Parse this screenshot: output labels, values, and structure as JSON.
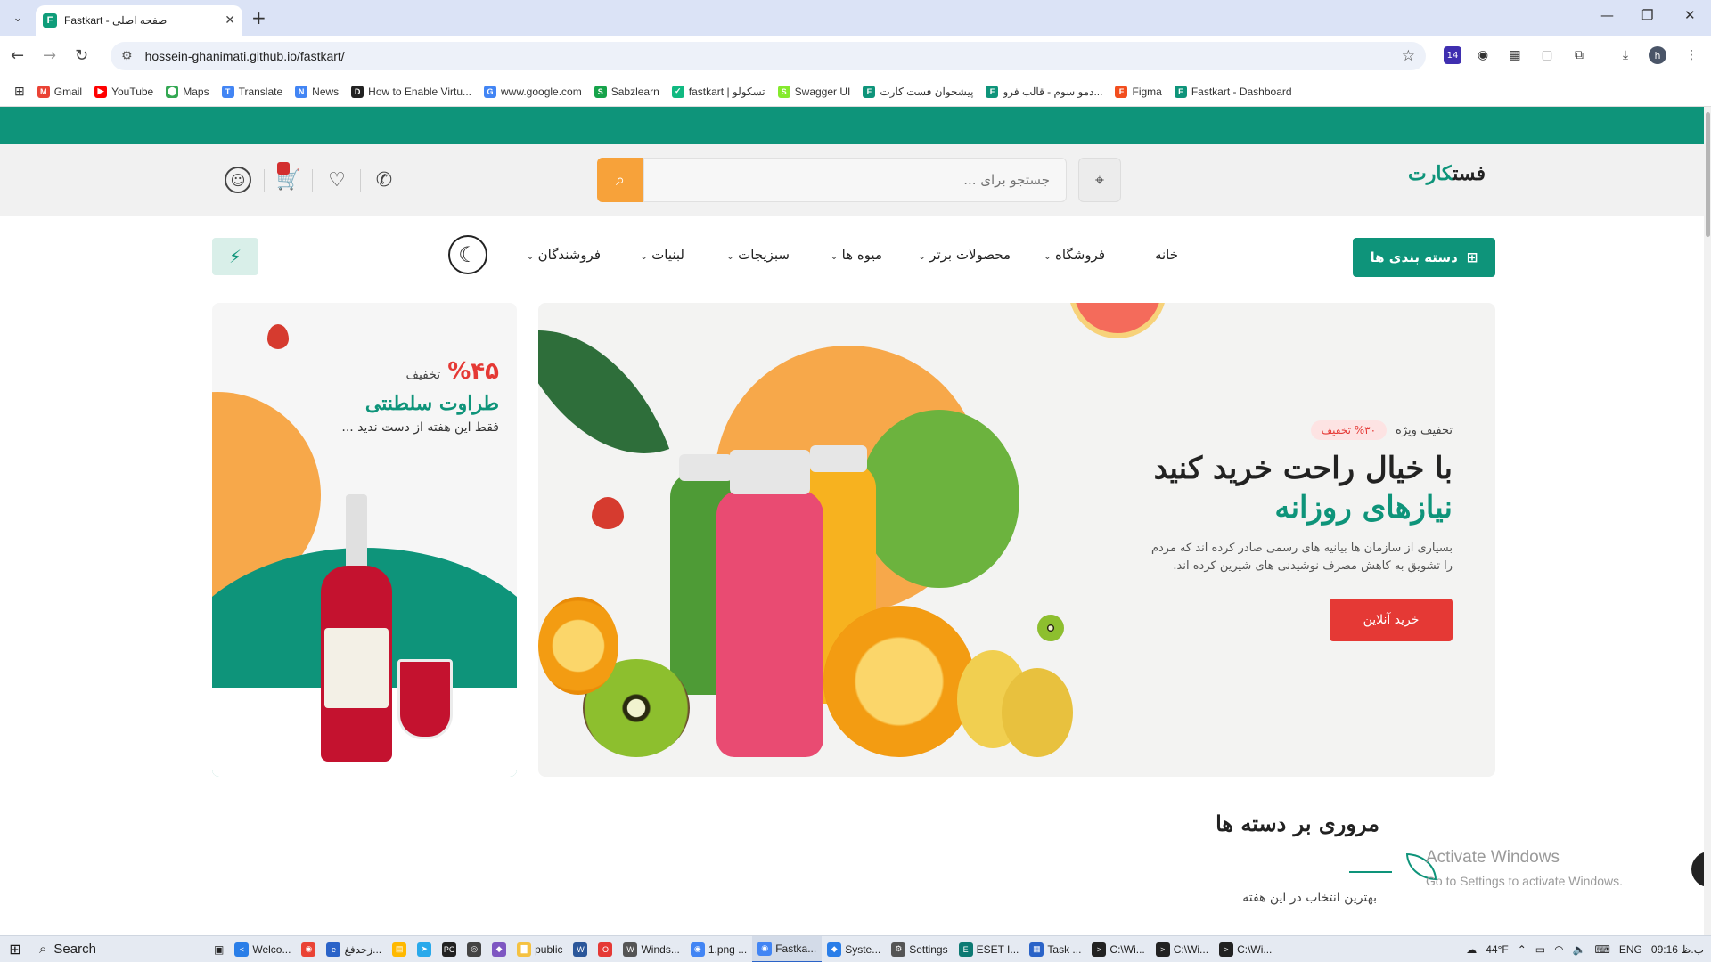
{
  "browser": {
    "tab_title": "Fastkart - صفحه اصلی",
    "favicon_letter": "F",
    "url": "hossein-ghanimati.github.io/fastkart/",
    "ext_badge": "14",
    "profile_letter": "h"
  },
  "bookmarks": [
    {
      "label": "Gmail",
      "color": "#ea4335",
      "glyph": "M"
    },
    {
      "label": "YouTube",
      "color": "#ff0000",
      "glyph": "▶"
    },
    {
      "label": "Maps",
      "color": "#34a853",
      "glyph": "⬤"
    },
    {
      "label": "Translate",
      "color": "#4285f4",
      "glyph": "T"
    },
    {
      "label": "News",
      "color": "#4285f4",
      "glyph": "N"
    },
    {
      "label": "How to Enable Virtu...",
      "color": "#222222",
      "glyph": "D"
    },
    {
      "label": "www.google.com",
      "color": "#4285f4",
      "glyph": "G"
    },
    {
      "label": "Sabzlearn",
      "color": "#16a34a",
      "glyph": "S"
    },
    {
      "label": "fastkart | تسکولو",
      "color": "#10b981",
      "glyph": "✓"
    },
    {
      "label": "Swagger UI",
      "color": "#85ea2d",
      "glyph": "S"
    },
    {
      "label": "پیشخوان فست کارت",
      "color": "#0e947a",
      "glyph": "F"
    },
    {
      "label": "دمو سوم - قالب فرو...",
      "color": "#0e947a",
      "glyph": "F"
    },
    {
      "label": "Figma",
      "color": "#f24e1e",
      "glyph": "F"
    },
    {
      "label": "Fastkart - Dashboard",
      "color": "#0e947a",
      "glyph": "F"
    }
  ],
  "site": {
    "logo_main": "فست",
    "logo_accent": "کارت",
    "search_placeholder": "جستجو برای ...",
    "cart_badge": "",
    "categories_button": "دسته بندی ها",
    "nav": [
      {
        "label": "خانه",
        "has_dropdown": false
      },
      {
        "label": "فروشگاه",
        "has_dropdown": true
      },
      {
        "label": "محصولات برتر",
        "has_dropdown": true
      },
      {
        "label": "میوه ها",
        "has_dropdown": true
      },
      {
        "label": "سبزیجات",
        "has_dropdown": true
      },
      {
        "label": "لبنیات",
        "has_dropdown": true
      },
      {
        "label": "فروشندگان",
        "has_dropdown": true
      }
    ],
    "hero": {
      "special_label": "تخفیف ویژه",
      "badge": "%۳۰ تخفیف",
      "title": "با خیال راحت خرید کنید",
      "subtitle": "نیازهای روزانه",
      "description": "بسیاری از سازمان ها بیانیه های رسمی صادر کرده اند که مردم را تشویق به کاهش مصرف نوشیدنی های شیرین کرده اند.",
      "button": "خرید آنلاین"
    },
    "promo": {
      "percent": "%۴۵",
      "off_label": "تخفیف",
      "title": "طراوت سلطنتی",
      "description": "فقط این هفته از دست ندید ..."
    },
    "section": {
      "title": "مروری بر دسته ها",
      "subtitle": "بهترین انتخاب در این هفته"
    },
    "watermark": {
      "line1": "Activate Windows",
      "line2": "Go to Settings to activate Windows."
    }
  },
  "taskbar": {
    "search_label": "Search",
    "items": [
      {
        "label": "Welco...",
        "color": "#2a7ee8",
        "glyph": "<"
      },
      {
        "label": "",
        "color": "#ea4335",
        "glyph": "◉"
      },
      {
        "label": "زخدفغ...",
        "color": "#2a63c8",
        "glyph": "e"
      },
      {
        "label": "",
        "color": "#ffb900",
        "glyph": "▤"
      },
      {
        "label": "",
        "color": "#29a9eb",
        "glyph": "➤"
      },
      {
        "label": "",
        "color": "#222222",
        "glyph": "PC"
      },
      {
        "label": "",
        "color": "#444444",
        "glyph": "◎"
      },
      {
        "label": "",
        "color": "#7e57c2",
        "glyph": "◆"
      },
      {
        "label": "public",
        "color": "#f5c242",
        "glyph": "▇"
      },
      {
        "label": "",
        "color": "#2b579a",
        "glyph": "W"
      },
      {
        "label": "",
        "color": "#e53935",
        "glyph": "O"
      },
      {
        "label": "Winds...",
        "color": "#555555",
        "glyph": "W"
      },
      {
        "label": "1.png ...",
        "color": "#4285f4",
        "glyph": "◉"
      },
      {
        "label": "Fastka...",
        "color": "#4285f4",
        "glyph": "◉",
        "active": true
      },
      {
        "label": "Syste...",
        "color": "#2a7ee8",
        "glyph": "◆"
      },
      {
        "label": "Settings",
        "color": "#555555",
        "glyph": "⚙"
      },
      {
        "label": "ESET I...",
        "color": "#0d7a73",
        "glyph": "E"
      },
      {
        "label": "Task ...",
        "color": "#2a63c8",
        "glyph": "▦"
      },
      {
        "label": "C:\\Wi...",
        "color": "#222222",
        "glyph": ">"
      },
      {
        "label": "C:\\Wi...",
        "color": "#222222",
        "glyph": ">"
      },
      {
        "label": "C:\\Wi...",
        "color": "#222222",
        "glyph": ">"
      }
    ],
    "weather": "44°F",
    "lang": "ENG",
    "time": "09:16 ب.ظ"
  }
}
